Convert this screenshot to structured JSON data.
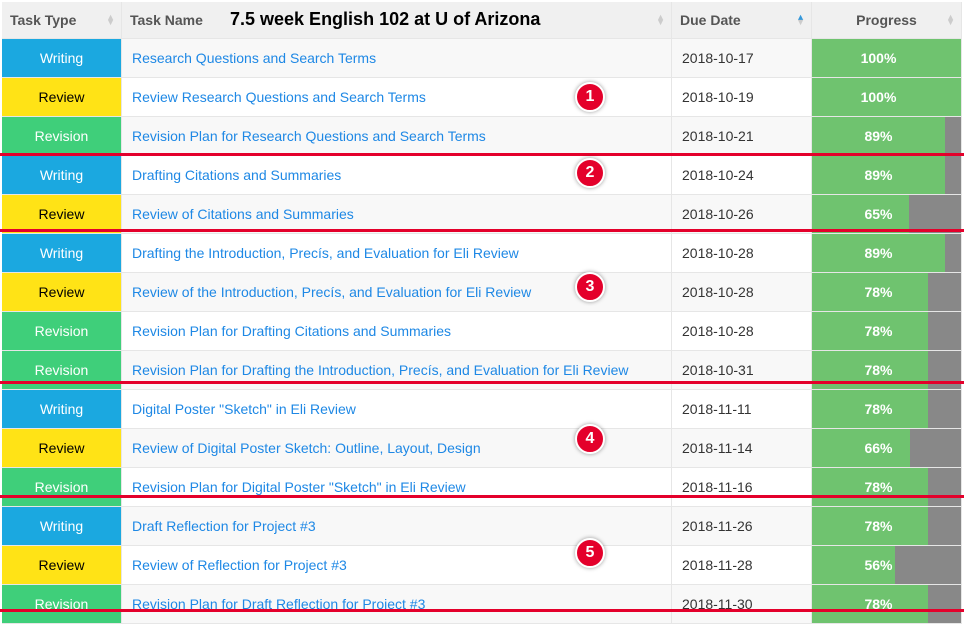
{
  "overlay_title": "7.5 week English 102 at U of Arizona",
  "headers": {
    "type": "Task Type",
    "name": "Task Name",
    "due": "Due Date",
    "progress": "Progress"
  },
  "sorted_column": "due",
  "sorted_dir": "asc",
  "rows": [
    {
      "type": "Writing",
      "name": "Research Questions and Search Terms",
      "due": "2018-10-17",
      "progress": 100
    },
    {
      "type": "Review",
      "name": "Review Research Questions and Search Terms",
      "due": "2018-10-19",
      "progress": 100
    },
    {
      "type": "Revision",
      "name": "Revision Plan for Research Questions and Search Terms",
      "due": "2018-10-21",
      "progress": 89
    },
    {
      "type": "Writing",
      "name": "Drafting Citations and Summaries",
      "due": "2018-10-24",
      "progress": 89
    },
    {
      "type": "Review",
      "name": "Review of Citations and Summaries",
      "due": "2018-10-26",
      "progress": 65
    },
    {
      "type": "Writing",
      "name": "Drafting the Introduction, Precís, and Evaluation for Eli Review",
      "due": "2018-10-28",
      "progress": 89
    },
    {
      "type": "Review",
      "name": "Review of the Introduction, Precís, and Evaluation for Eli Review",
      "due": "2018-10-28",
      "progress": 78
    },
    {
      "type": "Revision",
      "name": "Revision Plan for Drafting Citations and Summaries",
      "due": "2018-10-28",
      "progress": 78
    },
    {
      "type": "Revision",
      "name": "Revision Plan for Drafting the Introduction, Precís, and Evaluation for Eli Review",
      "due": "2018-10-31",
      "progress": 78
    },
    {
      "type": "Writing",
      "name": "Digital Poster \"Sketch\" in Eli Review",
      "due": "2018-11-11",
      "progress": 78
    },
    {
      "type": "Review",
      "name": "Review of Digital Poster Sketch: Outline, Layout, Design",
      "due": "2018-11-14",
      "progress": 66
    },
    {
      "type": "Revision",
      "name": "Revision Plan for Digital Poster \"Sketch\" in Eli Review",
      "due": "2018-11-16",
      "progress": 78
    },
    {
      "type": "Writing",
      "name": "Draft Reflection for Project #3",
      "due": "2018-11-26",
      "progress": 78
    },
    {
      "type": "Review",
      "name": "Review of Reflection for Project #3",
      "due": "2018-11-28",
      "progress": 56
    },
    {
      "type": "Revision",
      "name": "Revision Plan for Draft Reflection for Project #3",
      "due": "2018-11-30",
      "progress": 78
    }
  ],
  "annotations": [
    {
      "label": "1",
      "after_row_index": 2
    },
    {
      "label": "2",
      "after_row_index": 4
    },
    {
      "label": "3",
      "after_row_index": 8
    },
    {
      "label": "4",
      "after_row_index": 11
    },
    {
      "label": "5",
      "after_row_index": 14
    }
  ],
  "annot_callouts": [
    {
      "label": "1",
      "row": 1
    },
    {
      "label": "2",
      "row": 3
    },
    {
      "label": "3",
      "row": 6
    },
    {
      "label": "4",
      "row": 10
    },
    {
      "label": "5",
      "row": 13
    }
  ]
}
